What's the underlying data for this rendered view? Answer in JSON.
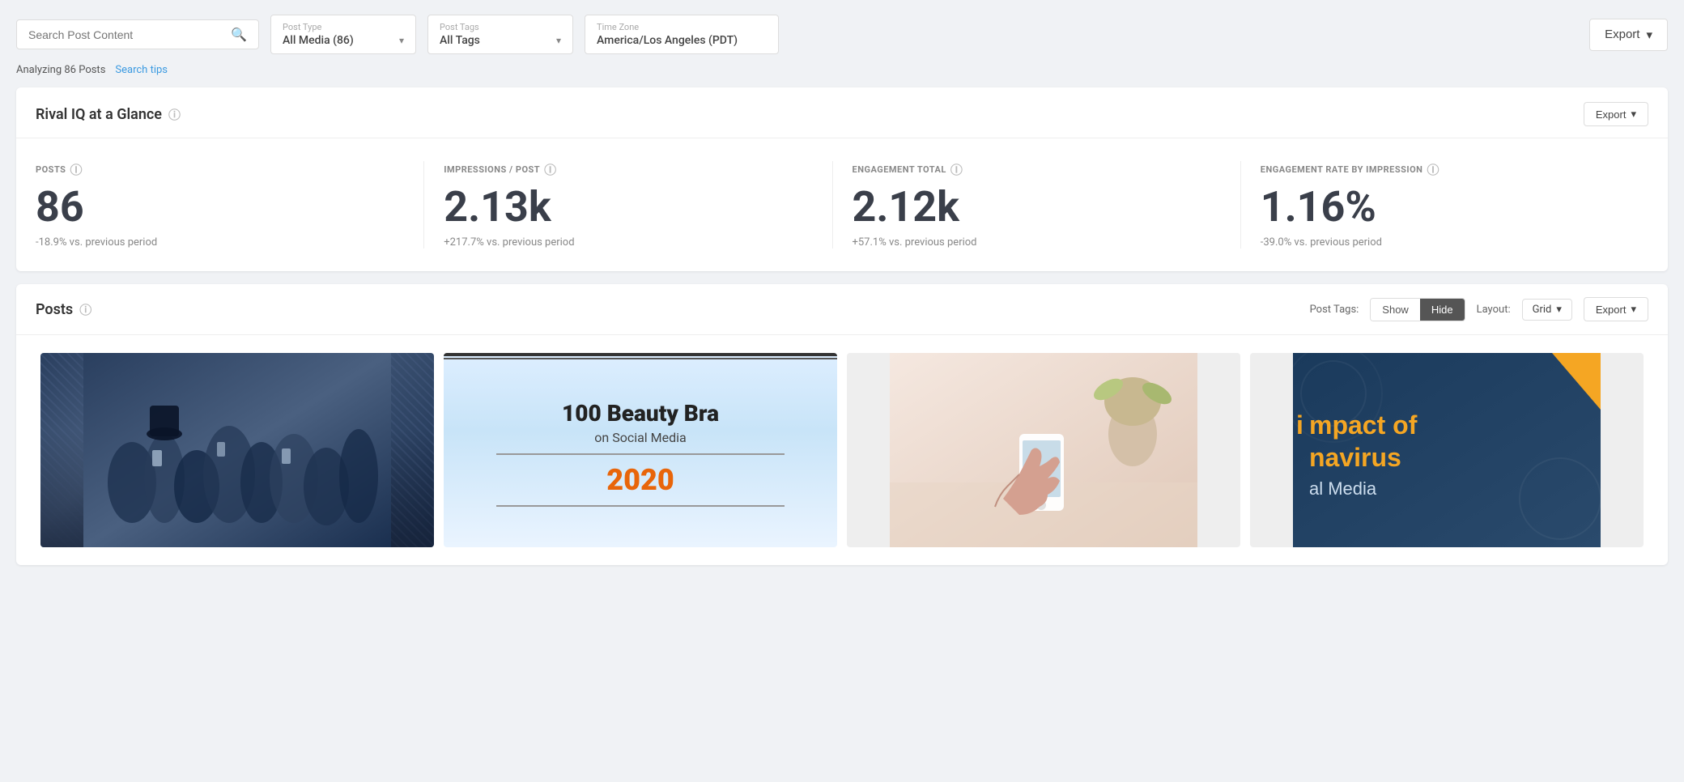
{
  "toolbar": {
    "search_placeholder": "Search Post Content",
    "search_icon": "🔍",
    "post_type_label": "Post Type",
    "post_type_value": "All Media (86)",
    "post_tags_label": "Post Tags",
    "post_tags_value": "All Tags",
    "timezone_label": "Time Zone",
    "timezone_value": "America/Los Angeles (PDT)",
    "export_label": "Export",
    "chevron": "▾"
  },
  "sub_toolbar": {
    "analyzing_text": "Analyzing 86 Posts",
    "search_tips_label": "Search tips"
  },
  "glance_card": {
    "title": "Rival IQ at a Glance",
    "export_label": "Export",
    "chevron": "▾",
    "metrics": [
      {
        "label": "POSTS",
        "value": "86",
        "change": "-18.9% vs. previous period"
      },
      {
        "label": "IMPRESSIONS / POST",
        "value": "2.13k",
        "change": "+217.7% vs. previous period"
      },
      {
        "label": "ENGAGEMENT TOTAL",
        "value": "2.12k",
        "change": "+57.1% vs. previous period"
      },
      {
        "label": "ENGAGEMENT RATE BY IMPRESSION",
        "value": "1.16%",
        "change": "-39.0% vs. previous period"
      }
    ]
  },
  "posts_card": {
    "title": "Posts",
    "post_tags_label": "Post Tags:",
    "show_label": "Show",
    "hide_label": "Hide",
    "layout_label": "Layout:",
    "layout_value": "Grid",
    "export_label": "Export",
    "chevron": "▾",
    "post1": {
      "title": "",
      "description": "Dark crowd social media image"
    },
    "post2": {
      "line1": "100 Beauty Bra",
      "line2": "on Social Media",
      "year": "2020"
    },
    "post3": {
      "description": "Phone usage photo"
    },
    "post4": {
      "title": "mpact of",
      "subtitle": "navirus",
      "body": "al Media"
    }
  }
}
